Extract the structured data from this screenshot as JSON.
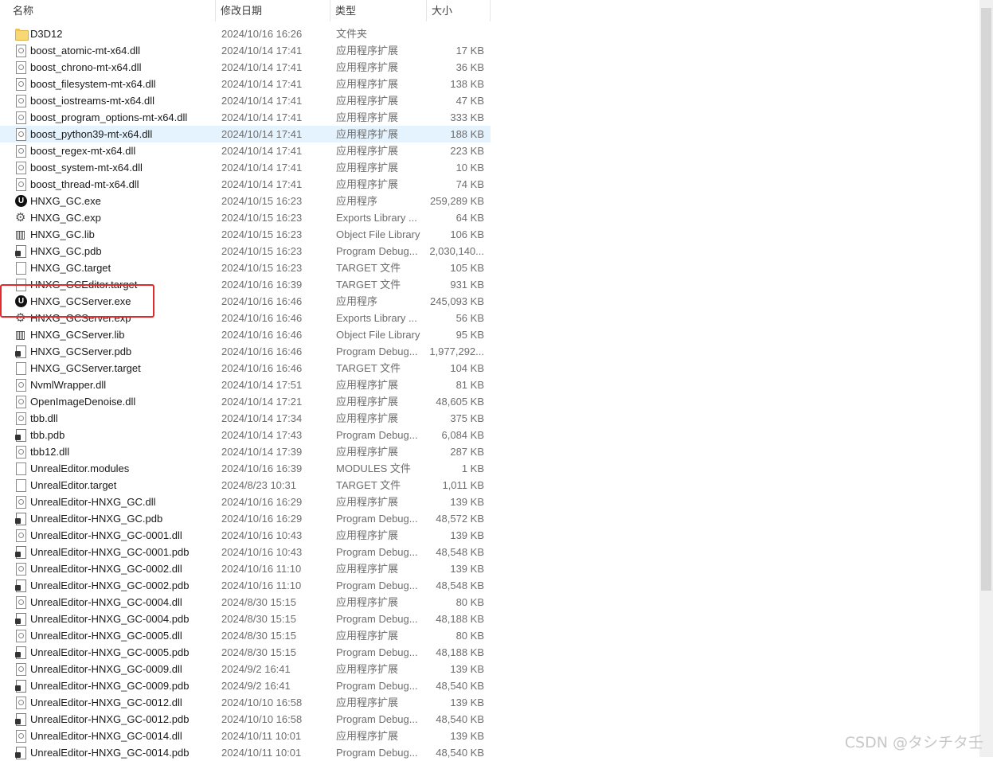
{
  "columns": {
    "name": "名称",
    "date": "修改日期",
    "type": "类型",
    "size": "大小"
  },
  "sort_indicator": "^",
  "files": [
    {
      "name": "D3D12",
      "date": "2024/10/16 16:26",
      "type": "文件夹",
      "size": "",
      "icon": "folder-icon"
    },
    {
      "name": "boost_atomic-mt-x64.dll",
      "date": "2024/10/14 17:41",
      "type": "应用程序扩展",
      "size": "17 KB",
      "icon": "dll-file-icon"
    },
    {
      "name": "boost_chrono-mt-x64.dll",
      "date": "2024/10/14 17:41",
      "type": "应用程序扩展",
      "size": "36 KB",
      "icon": "dll-file-icon"
    },
    {
      "name": "boost_filesystem-mt-x64.dll",
      "date": "2024/10/14 17:41",
      "type": "应用程序扩展",
      "size": "138 KB",
      "icon": "dll-file-icon"
    },
    {
      "name": "boost_iostreams-mt-x64.dll",
      "date": "2024/10/14 17:41",
      "type": "应用程序扩展",
      "size": "47 KB",
      "icon": "dll-file-icon"
    },
    {
      "name": "boost_program_options-mt-x64.dll",
      "date": "2024/10/14 17:41",
      "type": "应用程序扩展",
      "size": "333 KB",
      "icon": "dll-file-icon"
    },
    {
      "name": "boost_python39-mt-x64.dll",
      "date": "2024/10/14 17:41",
      "type": "应用程序扩展",
      "size": "188 KB",
      "icon": "dll-file-icon",
      "selected": true
    },
    {
      "name": "boost_regex-mt-x64.dll",
      "date": "2024/10/14 17:41",
      "type": "应用程序扩展",
      "size": "223 KB",
      "icon": "dll-file-icon"
    },
    {
      "name": "boost_system-mt-x64.dll",
      "date": "2024/10/14 17:41",
      "type": "应用程序扩展",
      "size": "10 KB",
      "icon": "dll-file-icon"
    },
    {
      "name": "boost_thread-mt-x64.dll",
      "date": "2024/10/14 17:41",
      "type": "应用程序扩展",
      "size": "74 KB",
      "icon": "dll-file-icon"
    },
    {
      "name": "HNXG_GC.exe",
      "date": "2024/10/15 16:23",
      "type": "应用程序",
      "size": "259,289 KB",
      "icon": "unreal-app-icon"
    },
    {
      "name": "HNXG_GC.exp",
      "date": "2024/10/15 16:23",
      "type": "Exports Library ...",
      "size": "64 KB",
      "icon": "exp-file-icon"
    },
    {
      "name": "HNXG_GC.lib",
      "date": "2024/10/15 16:23",
      "type": "Object File Library",
      "size": "106 KB",
      "icon": "lib-file-icon"
    },
    {
      "name": "HNXG_GC.pdb",
      "date": "2024/10/15 16:23",
      "type": "Program Debug...",
      "size": "2,030,140...",
      "icon": "pdb-file-icon"
    },
    {
      "name": "HNXG_GC.target",
      "date": "2024/10/15 16:23",
      "type": "TARGET 文件",
      "size": "105 KB",
      "icon": "blank-file-icon"
    },
    {
      "name": "HNXG_GCEditor.target",
      "date": "2024/10/16 16:39",
      "type": "TARGET 文件",
      "size": "931 KB",
      "icon": "blank-file-icon"
    },
    {
      "name": "HNXG_GCServer.exe",
      "date": "2024/10/16 16:46",
      "type": "应用程序",
      "size": "245,093 KB",
      "icon": "unreal-app-icon"
    },
    {
      "name": "HNXG_GCServer.exp",
      "date": "2024/10/16 16:46",
      "type": "Exports Library ...",
      "size": "56 KB",
      "icon": "exp-file-icon"
    },
    {
      "name": "HNXG_GCServer.lib",
      "date": "2024/10/16 16:46",
      "type": "Object File Library",
      "size": "95 KB",
      "icon": "lib-file-icon"
    },
    {
      "name": "HNXG_GCServer.pdb",
      "date": "2024/10/16 16:46",
      "type": "Program Debug...",
      "size": "1,977,292...",
      "icon": "pdb-file-icon"
    },
    {
      "name": "HNXG_GCServer.target",
      "date": "2024/10/16 16:46",
      "type": "TARGET 文件",
      "size": "104 KB",
      "icon": "blank-file-icon"
    },
    {
      "name": "NvmlWrapper.dll",
      "date": "2024/10/14 17:51",
      "type": "应用程序扩展",
      "size": "81 KB",
      "icon": "dll-file-icon"
    },
    {
      "name": "OpenImageDenoise.dll",
      "date": "2024/10/14 17:21",
      "type": "应用程序扩展",
      "size": "48,605 KB",
      "icon": "dll-file-icon"
    },
    {
      "name": "tbb.dll",
      "date": "2024/10/14 17:34",
      "type": "应用程序扩展",
      "size": "375 KB",
      "icon": "dll-file-icon"
    },
    {
      "name": "tbb.pdb",
      "date": "2024/10/14 17:43",
      "type": "Program Debug...",
      "size": "6,084 KB",
      "icon": "pdb-file-icon"
    },
    {
      "name": "tbb12.dll",
      "date": "2024/10/14 17:39",
      "type": "应用程序扩展",
      "size": "287 KB",
      "icon": "dll-file-icon"
    },
    {
      "name": "UnrealEditor.modules",
      "date": "2024/10/16 16:39",
      "type": "MODULES 文件",
      "size": "1 KB",
      "icon": "blank-file-icon"
    },
    {
      "name": "UnrealEditor.target",
      "date": "2024/8/23 10:31",
      "type": "TARGET 文件",
      "size": "1,011 KB",
      "icon": "blank-file-icon"
    },
    {
      "name": "UnrealEditor-HNXG_GC.dll",
      "date": "2024/10/16 16:29",
      "type": "应用程序扩展",
      "size": "139 KB",
      "icon": "dll-file-icon"
    },
    {
      "name": "UnrealEditor-HNXG_GC.pdb",
      "date": "2024/10/16 16:29",
      "type": "Program Debug...",
      "size": "48,572 KB",
      "icon": "pdb-file-icon"
    },
    {
      "name": "UnrealEditor-HNXG_GC-0001.dll",
      "date": "2024/10/16 10:43",
      "type": "应用程序扩展",
      "size": "139 KB",
      "icon": "dll-file-icon"
    },
    {
      "name": "UnrealEditor-HNXG_GC-0001.pdb",
      "date": "2024/10/16 10:43",
      "type": "Program Debug...",
      "size": "48,548 KB",
      "icon": "pdb-file-icon"
    },
    {
      "name": "UnrealEditor-HNXG_GC-0002.dll",
      "date": "2024/10/16 11:10",
      "type": "应用程序扩展",
      "size": "139 KB",
      "icon": "dll-file-icon"
    },
    {
      "name": "UnrealEditor-HNXG_GC-0002.pdb",
      "date": "2024/10/16 11:10",
      "type": "Program Debug...",
      "size": "48,548 KB",
      "icon": "pdb-file-icon"
    },
    {
      "name": "UnrealEditor-HNXG_GC-0004.dll",
      "date": "2024/8/30 15:15",
      "type": "应用程序扩展",
      "size": "80 KB",
      "icon": "dll-file-icon"
    },
    {
      "name": "UnrealEditor-HNXG_GC-0004.pdb",
      "date": "2024/8/30 15:15",
      "type": "Program Debug...",
      "size": "48,188 KB",
      "icon": "pdb-file-icon"
    },
    {
      "name": "UnrealEditor-HNXG_GC-0005.dll",
      "date": "2024/8/30 15:15",
      "type": "应用程序扩展",
      "size": "80 KB",
      "icon": "dll-file-icon"
    },
    {
      "name": "UnrealEditor-HNXG_GC-0005.pdb",
      "date": "2024/8/30 15:15",
      "type": "Program Debug...",
      "size": "48,188 KB",
      "icon": "pdb-file-icon"
    },
    {
      "name": "UnrealEditor-HNXG_GC-0009.dll",
      "date": "2024/9/2 16:41",
      "type": "应用程序扩展",
      "size": "139 KB",
      "icon": "dll-file-icon"
    },
    {
      "name": "UnrealEditor-HNXG_GC-0009.pdb",
      "date": "2024/9/2 16:41",
      "type": "Program Debug...",
      "size": "48,540 KB",
      "icon": "pdb-file-icon"
    },
    {
      "name": "UnrealEditor-HNXG_GC-0012.dll",
      "date": "2024/10/10 16:58",
      "type": "应用程序扩展",
      "size": "139 KB",
      "icon": "dll-file-icon"
    },
    {
      "name": "UnrealEditor-HNXG_GC-0012.pdb",
      "date": "2024/10/10 16:58",
      "type": "Program Debug...",
      "size": "48,540 KB",
      "icon": "pdb-file-icon"
    },
    {
      "name": "UnrealEditor-HNXG_GC-0014.dll",
      "date": "2024/10/11 10:01",
      "type": "应用程序扩展",
      "size": "139 KB",
      "icon": "dll-file-icon"
    },
    {
      "name": "UnrealEditor-HNXG_GC-0014.pdb",
      "date": "2024/10/11 10:01",
      "type": "Program Debug...",
      "size": "48,540 KB",
      "icon": "pdb-file-icon"
    }
  ],
  "highlight_color": "#e22a2a",
  "selection_color": "#e5f3ff",
  "watermark": "CSDN @タシチタ壬"
}
